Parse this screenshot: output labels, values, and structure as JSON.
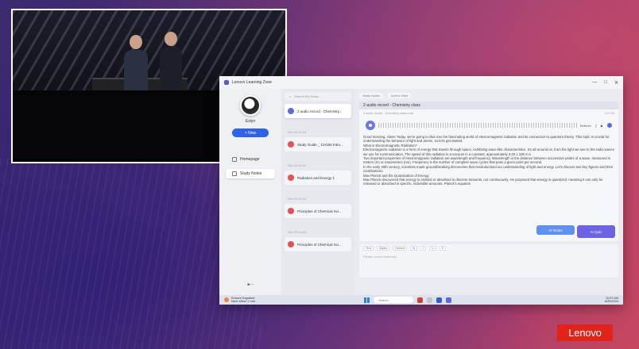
{
  "app": {
    "window_title": "Lenovo Learning Zone",
    "window_controls": [
      "—",
      "□",
      "✕"
    ],
    "user_name": "Eslyn",
    "new_button": "+ New",
    "nav": [
      {
        "label": "Homepage"
      },
      {
        "label": "Study Notes"
      }
    ],
    "nav_footer": "■—"
  },
  "notes_list": {
    "search_placeholder": "Search My Notes",
    "items": [
      {
        "title": "2 audio record - Chemistry...",
        "time": "",
        "type": "audio"
      },
      {
        "title": "Study Guide _ CH150 Intro...",
        "time": "Wed 08:45 AM",
        "type": "doc"
      },
      {
        "title": "Radiation and Energy 1",
        "time": "Wed 08:45 AM",
        "type": "doc"
      },
      {
        "title": "Principles of Chemical Sci...",
        "time": "Wed 08:45 AM",
        "type": "doc"
      },
      {
        "title": "Principles of Chemical Sci...",
        "time": "Wed 08:45 AM",
        "type": "doc"
      }
    ]
  },
  "main": {
    "top_pills": [
      "Study Notes",
      "Add to Mind"
    ],
    "card_title": "2 audio record - Chemistry class",
    "card_sub_left": "2 audio record - Chemistry class.m4a",
    "card_sub_right": "1:27:00",
    "player_tools": [
      "Refresh"
    ],
    "transcript": [
      "Good morning, class! Today, we're going to dive into the fascinating world of electromagnetic radiation and its connection to quantum theory. This topic is crucial for understanding the behavior of light and atoms, so let's get started.",
      "What is Electromagnetic Radiation?",
      "Electromagnetic radiation is a form of energy that travels through space, exhibiting wave-like characteristics. It's all around us, from the light we see to the radio waves we use for communication. The speed of this radiation in a vacuum is a constant, approximately 3.00 x 108 m s",
      "Two important properties of electromagnetic radiation are wavelength and frequency. Wavelength is the distance between successive peaks of a wave, measured in meters (m) or nanometers (nm). Frequency is the number of complete wave cycles that pass a given point per second.",
      "In the early 20th century, scientists made groundbreaking discoveries that revolutionized our understanding of light and energy. Let's discuss two key figures and their contributions.",
      "Max Planck and the Quantization of Energy",
      "Max Planck discovered that energy is emitted or absorbed in discrete amounts, not continuously. He proposed that energy is quantized, meaning it can only be released or absorbed in specific, indivisible amounts. Planck's equation"
    ],
    "ai_notes_button": "AI Notes",
    "ai_quiz_button": "AI Quiz",
    "editor_tools": [
      "Text",
      "Styles",
      "Default",
      "B",
      "I",
      "U",
      "S"
    ],
    "editor_placeholder": "Please record materials"
  },
  "taskbar": {
    "weather_temp": "Ennore Kapaline",
    "weather_sub": "Next effect 1 min",
    "search_placeholder": "Search",
    "time": "10:57 AM",
    "date": "8/25/2024"
  },
  "brand": "Lenovo"
}
